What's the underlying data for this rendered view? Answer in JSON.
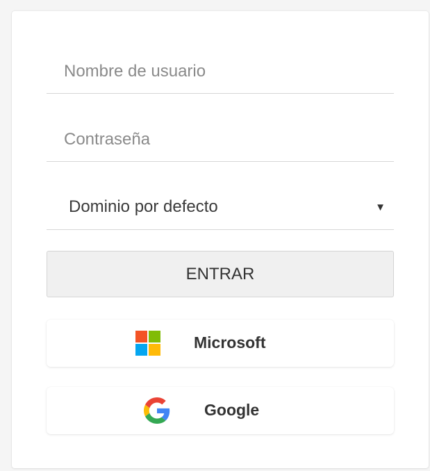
{
  "form": {
    "username_placeholder": "Nombre de usuario",
    "password_placeholder": "Contraseña",
    "domain_selected": "Dominio por defecto",
    "login_label": "ENTRAR"
  },
  "sso": {
    "microsoft": {
      "label": "Microsoft",
      "icon": "microsoft-logo-icon"
    },
    "google": {
      "label": "Google",
      "icon": "google-logo-icon"
    }
  },
  "icons": {
    "dropdown": "caret-down-icon"
  },
  "colors": {
    "ms_red": "#F35325",
    "ms_green": "#81BC06",
    "ms_blue": "#05A6F0",
    "ms_yellow": "#FFBA08",
    "g_blue": "#4285F4",
    "g_red": "#EA4335",
    "g_yellow": "#FBBC05",
    "g_green": "#34A853"
  }
}
